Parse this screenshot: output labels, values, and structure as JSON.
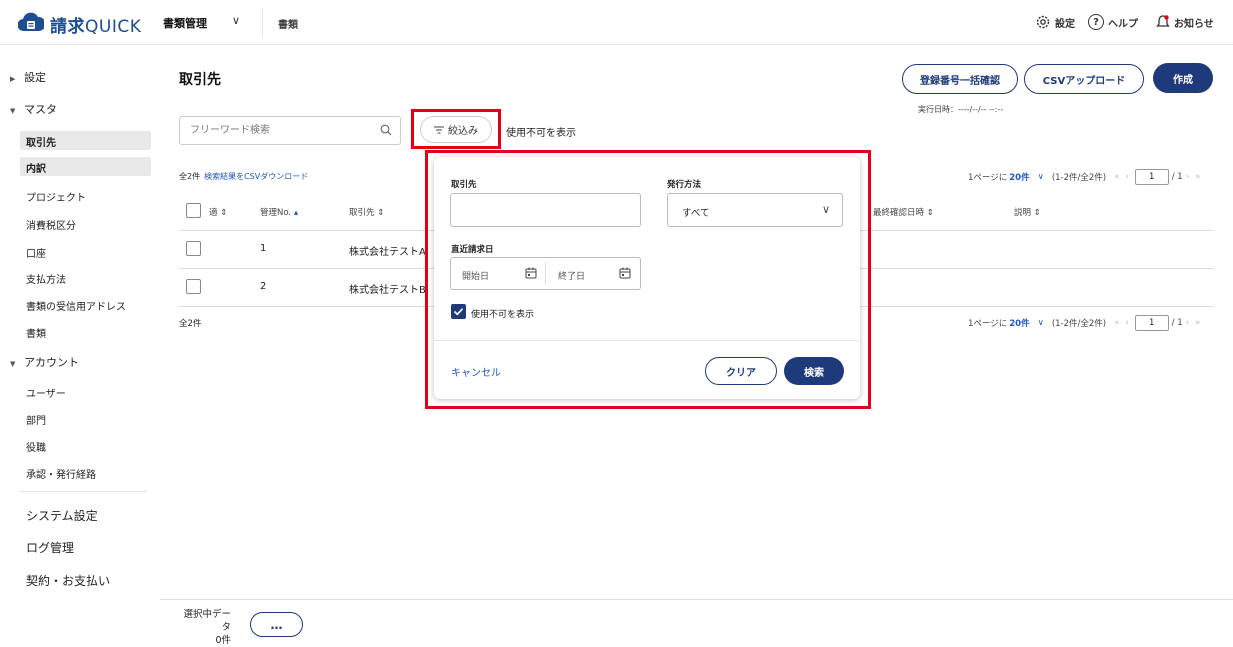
{
  "header": {
    "logo_text_bold": "請求",
    "logo_text_rest": "QUICK",
    "menu_label": "書類管理",
    "menu_chevron": "∨",
    "doc_label": "書類",
    "settings_label": "設定",
    "help_label": "ヘルプ",
    "notice_label": "お知らせ",
    "help_glyph": "?"
  },
  "sidebar": {
    "sections": [
      {
        "label": "設定",
        "expanded": false
      },
      {
        "label": "マスタ",
        "expanded": true
      },
      {
        "label": "アカウント",
        "expanded": true
      }
    ],
    "master_items": [
      "取引先",
      "内訳",
      "プロジェクト",
      "消費税区分",
      "口座",
      "支払方法",
      "書類の受信用アドレス",
      "書類"
    ],
    "account_items": [
      "ユーザー",
      "部門",
      "役職",
      "承認・発行経路"
    ],
    "bottom_items": [
      "システム設定",
      "ログ管理",
      "契約・お支払い"
    ]
  },
  "main": {
    "title": "取引先",
    "btn_bulk_check": "登録番号一括確認",
    "btn_csv_upload": "CSVアップロード",
    "btn_create": "作成",
    "exec_date": "実行日時：----/--/-- --:--",
    "search_placeholder": "フリーワード検索",
    "filter_label": "絞込み",
    "show_disabled": "使用不可を表示",
    "count_label": "全2件",
    "csv_download_link": "検索結果をCSVダウンロード",
    "total_bottom": "全2件",
    "pager": {
      "per_page_prefix": "1ページに",
      "per_page_value": "20件",
      "range": "(1-2件/全2件)",
      "current_page": "1",
      "total_pages": "/ 1"
    },
    "columns": {
      "col1": "適",
      "mgmt_no": "管理No.",
      "partner": "取引先",
      "last_checked": "最終確認日時",
      "description": "説明"
    },
    "rows": [
      {
        "no": "1",
        "partner": "株式会社テストA"
      },
      {
        "no": "2",
        "partner": "株式会社テストB"
      }
    ]
  },
  "filter_popup": {
    "partner_label": "取引先",
    "partner_value": "",
    "method_label": "発行方法",
    "method_value": "すべて",
    "recent_label": "直近請求日",
    "start_placeholder": "開始日",
    "end_placeholder": "終了日",
    "show_disabled_label": "使用不可を表示",
    "show_disabled_checked": true,
    "cancel_label": "キャンセル",
    "clear_label": "クリア",
    "search_label": "検索"
  },
  "bottom": {
    "selected_label": "選択中データ",
    "selected_count": "0件",
    "more_label": "…"
  },
  "colors": {
    "brand": "#1e4d92",
    "primary": "#1e3a7b",
    "link": "#1f56c5",
    "highlight": "#e4001b"
  }
}
